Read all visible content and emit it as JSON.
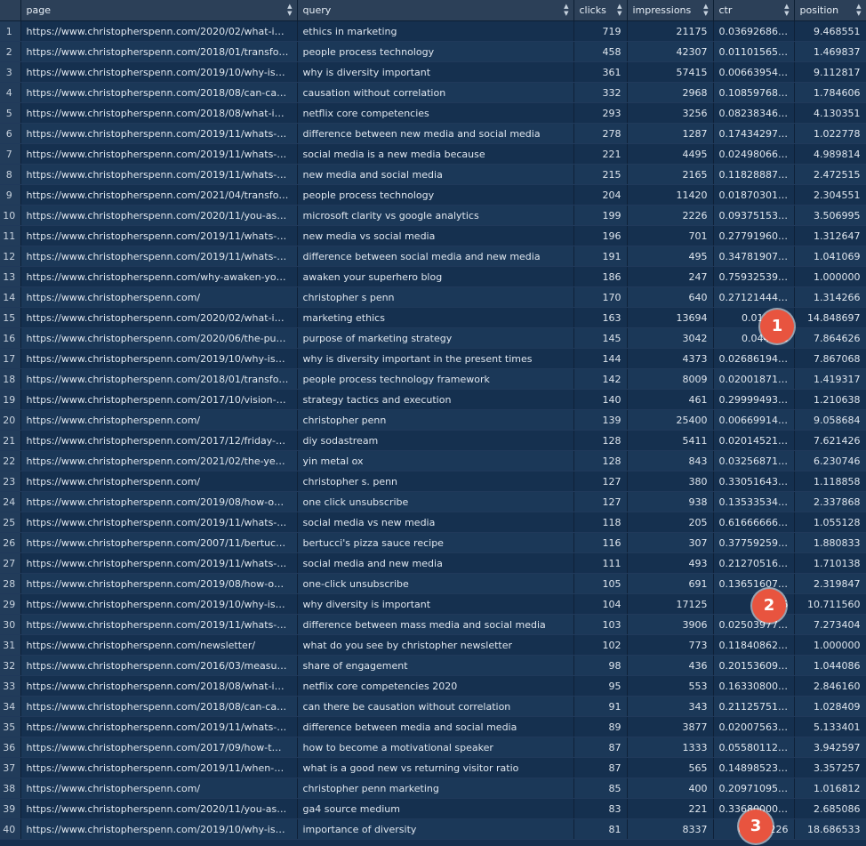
{
  "columns": [
    "page",
    "query",
    "clicks",
    "impressions",
    "ctr",
    "position"
  ],
  "rows": [
    {
      "idx": "1",
      "page": "https://www.christopherspenn.com/2020/02/what-i…",
      "query": "ethics in marketing",
      "clicks": "719",
      "impressions": "21175",
      "ctr": "0.0369268681",
      "position": "9.468551"
    },
    {
      "idx": "2",
      "page": "https://www.christopherspenn.com/2018/01/transfo…",
      "query": "people process technology",
      "clicks": "458",
      "impressions": "42307",
      "ctr": "0.0110156566",
      "position": "1.469837"
    },
    {
      "idx": "3",
      "page": "https://www.christopherspenn.com/2019/10/why-is…",
      "query": "why is diversity important",
      "clicks": "361",
      "impressions": "57415",
      "ctr": "0.0066395469",
      "position": "9.112817"
    },
    {
      "idx": "4",
      "page": "https://www.christopherspenn.com/2018/08/can-ca…",
      "query": "causation without correlation",
      "clicks": "332",
      "impressions": "2968",
      "ctr": "0.1085976802",
      "position": "1.784606"
    },
    {
      "idx": "5",
      "page": "https://www.christopherspenn.com/2018/08/what-i…",
      "query": "netflix core competencies",
      "clicks": "293",
      "impressions": "3256",
      "ctr": "0.0823834658",
      "position": "4.130351"
    },
    {
      "idx": "6",
      "page": "https://www.christopherspenn.com/2019/11/whats-…",
      "query": "difference between new media and social media",
      "clicks": "278",
      "impressions": "1287",
      "ctr": "0.1743429712",
      "position": "1.022778"
    },
    {
      "idx": "7",
      "page": "https://www.christopherspenn.com/2019/11/whats-…",
      "query": "social media is a new media because",
      "clicks": "221",
      "impressions": "4495",
      "ctr": "0.0249806647",
      "position": "4.989814"
    },
    {
      "idx": "8",
      "page": "https://www.christopherspenn.com/2019/11/whats-…",
      "query": "new media and social media",
      "clicks": "215",
      "impressions": "2165",
      "ctr": "0.1182888722",
      "position": "2.472515"
    },
    {
      "idx": "9",
      "page": "https://www.christopherspenn.com/2021/04/transfo…",
      "query": "people process technology",
      "clicks": "204",
      "impressions": "11420",
      "ctr": "0.0187030185",
      "position": "2.304551"
    },
    {
      "idx": "10",
      "page": "https://www.christopherspenn.com/2020/11/you-as…",
      "query": "microsoft clarity vs google analytics",
      "clicks": "199",
      "impressions": "2226",
      "ctr": "0.0937515329",
      "position": "3.506995"
    },
    {
      "idx": "11",
      "page": "https://www.christopherspenn.com/2019/11/whats-…",
      "query": "new media vs social media",
      "clicks": "196",
      "impressions": "701",
      "ctr": "0.2779196035",
      "position": "1.312647"
    },
    {
      "idx": "12",
      "page": "https://www.christopherspenn.com/2019/11/whats-…",
      "query": "difference between social media and new media",
      "clicks": "191",
      "impressions": "495",
      "ctr": "0.3478190798",
      "position": "1.041069"
    },
    {
      "idx": "13",
      "page": "https://www.christopherspenn.com/why-awaken-yo…",
      "query": "awaken your superhero blog",
      "clicks": "186",
      "impressions": "247",
      "ctr": "0.7593253968",
      "position": "1.000000"
    },
    {
      "idx": "14",
      "page": "https://www.christopherspenn.com/",
      "query": "christopher s penn",
      "clicks": "170",
      "impressions": "640",
      "ctr": "0.2712144486",
      "position": "1.314266"
    },
    {
      "idx": "15",
      "page": "https://www.christopherspenn.com/2020/02/what-i…",
      "query": "marketing ethics",
      "clicks": "163",
      "impressions": "13694",
      "ctr": "0.010063",
      "position": "14.848697"
    },
    {
      "idx": "16",
      "page": "https://www.christopherspenn.com/2020/06/the-pu…",
      "query": "purpose of marketing strategy",
      "clicks": "145",
      "impressions": "3042",
      "ctr": "0.044958",
      "position": "7.864626"
    },
    {
      "idx": "17",
      "page": "https://www.christopherspenn.com/2019/10/why-is…",
      "query": "why is diversity important in the present times",
      "clicks": "144",
      "impressions": "4373",
      "ctr": "0.0268619452",
      "position": "7.867068"
    },
    {
      "idx": "18",
      "page": "https://www.christopherspenn.com/2018/01/transfo…",
      "query": "people process technology framework",
      "clicks": "142",
      "impressions": "8009",
      "ctr": "0.0200187105",
      "position": "1.419317"
    },
    {
      "idx": "19",
      "page": "https://www.christopherspenn.com/2017/10/vision-…",
      "query": "strategy tactics and execution",
      "clicks": "140",
      "impressions": "461",
      "ctr": "0.2999949341",
      "position": "1.210638"
    },
    {
      "idx": "20",
      "page": "https://www.christopherspenn.com/",
      "query": "christopher penn",
      "clicks": "139",
      "impressions": "25400",
      "ctr": "0.0066991470",
      "position": "9.058684"
    },
    {
      "idx": "21",
      "page": "https://www.christopherspenn.com/2017/12/friday-…",
      "query": "diy sodastream",
      "clicks": "128",
      "impressions": "5411",
      "ctr": "0.0201452160",
      "position": "7.621426"
    },
    {
      "idx": "22",
      "page": "https://www.christopherspenn.com/2021/02/the-ye…",
      "query": "yin metal ox",
      "clicks": "128",
      "impressions": "843",
      "ctr": "0.0325687174",
      "position": "6.230746"
    },
    {
      "idx": "23",
      "page": "https://www.christopherspenn.com/",
      "query": "christopher s. penn",
      "clicks": "127",
      "impressions": "380",
      "ctr": "0.3305164319",
      "position": "1.118858"
    },
    {
      "idx": "24",
      "page": "https://www.christopherspenn.com/2019/08/how-o…",
      "query": "one click unsubscribe",
      "clicks": "127",
      "impressions": "938",
      "ctr": "0.1353353468",
      "position": "2.337868"
    },
    {
      "idx": "25",
      "page": "https://www.christopherspenn.com/2019/11/whats-…",
      "query": "social media vs new media",
      "clicks": "118",
      "impressions": "205",
      "ctr": "0.6166666667",
      "position": "1.055128"
    },
    {
      "idx": "26",
      "page": "https://www.christopherspenn.com/2007/11/bertuc…",
      "query": "bertucci's pizza sauce recipe",
      "clicks": "116",
      "impressions": "307",
      "ctr": "0.3775925926",
      "position": "1.880833"
    },
    {
      "idx": "27",
      "page": "https://www.christopherspenn.com/2019/11/whats-…",
      "query": "social media and new media",
      "clicks": "111",
      "impressions": "493",
      "ctr": "0.2127051631",
      "position": "1.710138"
    },
    {
      "idx": "28",
      "page": "https://www.christopherspenn.com/2019/08/how-o…",
      "query": "one-click unsubscribe",
      "clicks": "105",
      "impressions": "691",
      "ctr": "0.1365160780",
      "position": "2.319847"
    },
    {
      "idx": "29",
      "page": "https://www.christopherspenn.com/2019/10/why-is…",
      "query": "why diversity is important",
      "clicks": "104",
      "impressions": "17125",
      "ctr": "0.0065",
      "position": "10.711560"
    },
    {
      "idx": "30",
      "page": "https://www.christopherspenn.com/2019/11/whats-…",
      "query": "difference between mass media and social media",
      "clicks": "103",
      "impressions": "3906",
      "ctr": "0.0250397723",
      "position": "7.273404"
    },
    {
      "idx": "31",
      "page": "https://www.christopherspenn.com/newsletter/",
      "query": "what do you see by christopher newsletter",
      "clicks": "102",
      "impressions": "773",
      "ctr": "0.1184086200",
      "position": "1.000000"
    },
    {
      "idx": "32",
      "page": "https://www.christopherspenn.com/2016/03/measu…",
      "query": "share of engagement",
      "clicks": "98",
      "impressions": "436",
      "ctr": "0.2015360983",
      "position": "1.044086"
    },
    {
      "idx": "33",
      "page": "https://www.christopherspenn.com/2018/08/what-i…",
      "query": "netflix core competencies 2020",
      "clicks": "95",
      "impressions": "553",
      "ctr": "0.1633080041",
      "position": "2.846160"
    },
    {
      "idx": "34",
      "page": "https://www.christopherspenn.com/2018/08/can-ca…",
      "query": "can there be causation without correlation",
      "clicks": "91",
      "impressions": "343",
      "ctr": "0.2112575104",
      "position": "1.028409"
    },
    {
      "idx": "35",
      "page": "https://www.christopherspenn.com/2019/11/whats-…",
      "query": "difference between media and social media",
      "clicks": "89",
      "impressions": "3877",
      "ctr": "0.0200756354",
      "position": "5.133401"
    },
    {
      "idx": "36",
      "page": "https://www.christopherspenn.com/2017/09/how-t…",
      "query": "how to become a motivational speaker",
      "clicks": "87",
      "impressions": "1333",
      "ctr": "0.0558011227",
      "position": "3.942597"
    },
    {
      "idx": "37",
      "page": "https://www.christopherspenn.com/2019/11/when-…",
      "query": "what is a good new vs returning visitor ratio",
      "clicks": "87",
      "impressions": "565",
      "ctr": "0.1489852399",
      "position": "3.357257"
    },
    {
      "idx": "38",
      "page": "https://www.christopherspenn.com/",
      "query": "christopher penn marketing",
      "clicks": "85",
      "impressions": "400",
      "ctr": "0.2097109586",
      "position": "1.016812"
    },
    {
      "idx": "39",
      "page": "https://www.christopherspenn.com/2020/11/you-as…",
      "query": "ga4 source medium",
      "clicks": "83",
      "impressions": "221",
      "ctr": "0.3368000000",
      "position": "2.685086"
    },
    {
      "idx": "40",
      "page": "https://www.christopherspenn.com/2019/10/why-is…",
      "query": "importance of diversity",
      "clicks": "81",
      "impressions": "8337",
      "ctr": "0.00…226",
      "position": "18.686533"
    }
  ],
  "badges": [
    "1",
    "2",
    "3"
  ],
  "colors": {
    "badge": "#e8543f",
    "header": "#2c4058",
    "row_odd": "#15304f",
    "row_even": "#1b3858"
  }
}
